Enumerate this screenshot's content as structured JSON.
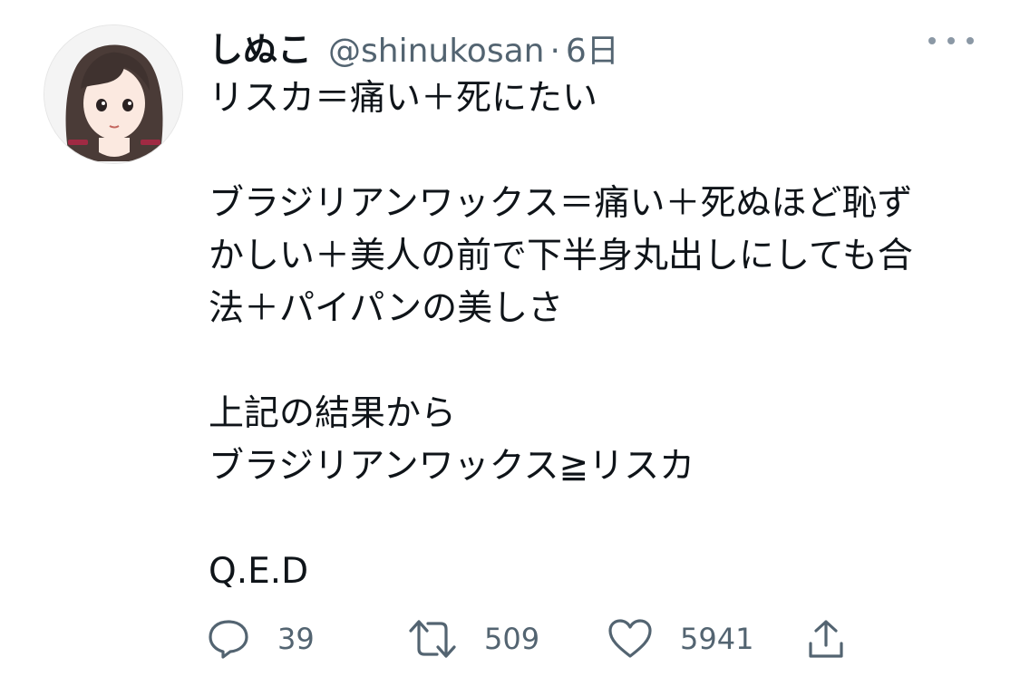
{
  "tweet": {
    "author": {
      "display_name": "しぬこ",
      "handle": "@shinukosan",
      "separator": "·",
      "time": "6日"
    },
    "avatar_icon": "avatar-illustration",
    "more_icon": "more-dots-icon",
    "lines": [
      "リスカ＝痛い＋死にたい",
      "",
      "ブラジリアンワックス＝痛い＋死ぬほど恥ず",
      "かしい＋美人の前で下半身丸出しにしても合",
      "法＋パイパンの美しさ",
      "",
      "上記の結果から",
      "ブラジリアンワックス≧リスカ",
      "",
      "Q.E.D"
    ],
    "stats": {
      "replies": "39",
      "retweets": "509",
      "likes": "5941"
    },
    "icons": {
      "reply": "reply-icon",
      "retweet": "retweet-icon",
      "like": "like-icon",
      "share": "share-icon"
    },
    "colors": {
      "text": "#0f1419",
      "secondary": "#536471"
    }
  }
}
